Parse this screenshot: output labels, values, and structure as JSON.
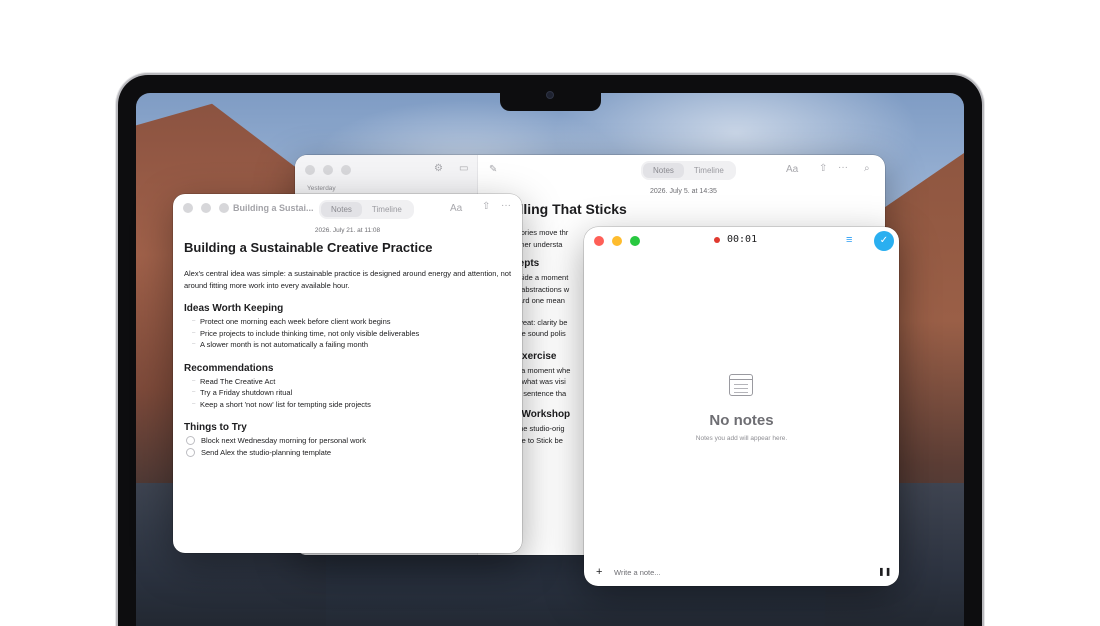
{
  "timer_label": "00:01",
  "back_window": {
    "tabs": [
      "Notes",
      "Timeline"
    ],
    "sidebar_group": "Yesterday",
    "date": "2026. July 5. at 14:35",
    "title": "telling That Sticks",
    "lines_intro": [
      "le stories move thr",
      "listener understa"
    ],
    "heading_1": "ncepts",
    "lines_1": [
      "n inside a moment",
      "ace abstractions w",
      " toward one mean"
    ],
    "lines_2": [
      ": caveat: clarity be",
      " prose sound polis"
    ],
    "heading_2": "e Exercise",
    "lines_3": [
      "ose a moment whe",
      "ribe what was visi",
      "very sentence tha"
    ],
    "heading_3": "ne Workshop",
    "lines_4": [
      "ite the studio-orig",
      "Made to Stick be"
    ]
  },
  "front_window": {
    "title": "Building a Sustai...",
    "tabs": [
      "Notes",
      "Timeline"
    ],
    "font_label": "Aa",
    "date": "2026. July 21. at 11:08",
    "heading": "Building a Sustainable Creative Practice",
    "intro": "Alex's central idea was simple: a sustainable practice is designed around energy and attention, not around fitting more work into every available hour.",
    "section_1": {
      "title": "Ideas Worth Keeping",
      "items": [
        "Protect one morning each week before client work begins",
        "Price projects to include thinking time, not only visible deliverables",
        "A slower month is not automatically a failing month"
      ]
    },
    "section_2": {
      "title": "Recommendations",
      "items": [
        "Read The Creative Act",
        "Try a Friday shutdown ritual",
        "Keep a short 'not now' list for tempting side projects"
      ]
    },
    "section_3": {
      "title": "Things to Try",
      "todos": [
        "Block next Wednesday morning for personal work",
        "Send Alex the studio-planning template"
      ]
    }
  },
  "notes_panel": {
    "empty_title": "No notes",
    "empty_subtitle": "Notes you add will appear here.",
    "input_placeholder": "Write a note...",
    "accent_color": "#2aaff0",
    "record_color": "#e0392f"
  }
}
